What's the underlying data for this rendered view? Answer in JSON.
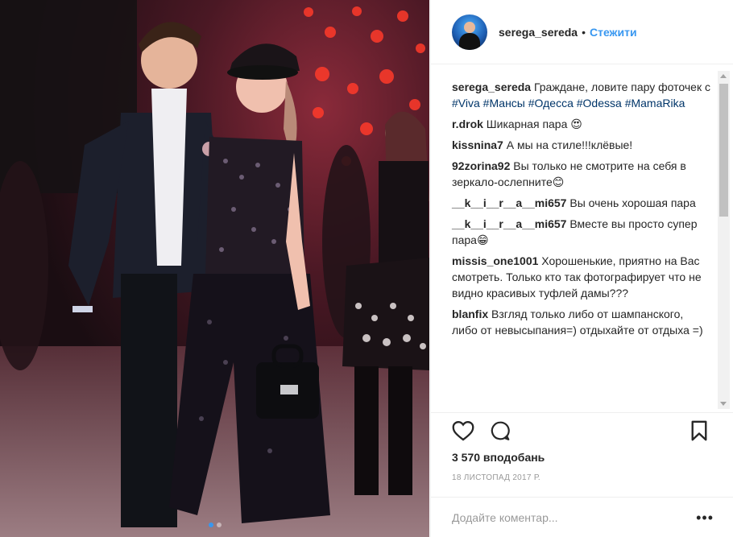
{
  "post": {
    "username": "serega_sereda",
    "separator": "•",
    "follow_label": "Стежити"
  },
  "caption": {
    "username": "serega_sereda",
    "text": "Граждане, ловите пару фоточек с",
    "hashtags": [
      "#Viva",
      "#Мансы",
      "#Одесса",
      "#Odessa",
      "#MamaRika"
    ]
  },
  "comments": [
    {
      "user": "r.drok",
      "text": "Шикарная пара 😍"
    },
    {
      "user": "kissnina7",
      "text": "А мы на стиле!!!клёвые!"
    },
    {
      "user": "92zorina92",
      "text": "Вы только не смотрите на себя в зеркало-ослепните😊"
    },
    {
      "user": "__k__i__r__a__mi657",
      "text": "Вы очень хорошая пара"
    },
    {
      "user": "__k__i__r__a__mi657",
      "text": "Вместе вы просто супер пара😁"
    },
    {
      "user": "missis_one1001",
      "text": "Хорошенькие, приятно на Вас смотреть. Только кто так фотографирует что не видно красивых туфлей дамы???"
    },
    {
      "user": "blanfix",
      "text": "Взгляд только либо от шампанского, либо от невысыпания=) отдыхайте от отдыха =)"
    }
  ],
  "icons": {
    "like": "heart-icon",
    "comment": "speech-bubble-icon",
    "save": "bookmark-icon",
    "more": "ellipsis-icon"
  },
  "likes": "3 570 вподобань",
  "date": "18 листопад 2017 р.",
  "add_comment": {
    "placeholder": "Додайте коментар...",
    "more_label": "•••"
  },
  "colors": {
    "accent": "#3897f0",
    "hashtag": "#003569",
    "muted": "#999999"
  }
}
